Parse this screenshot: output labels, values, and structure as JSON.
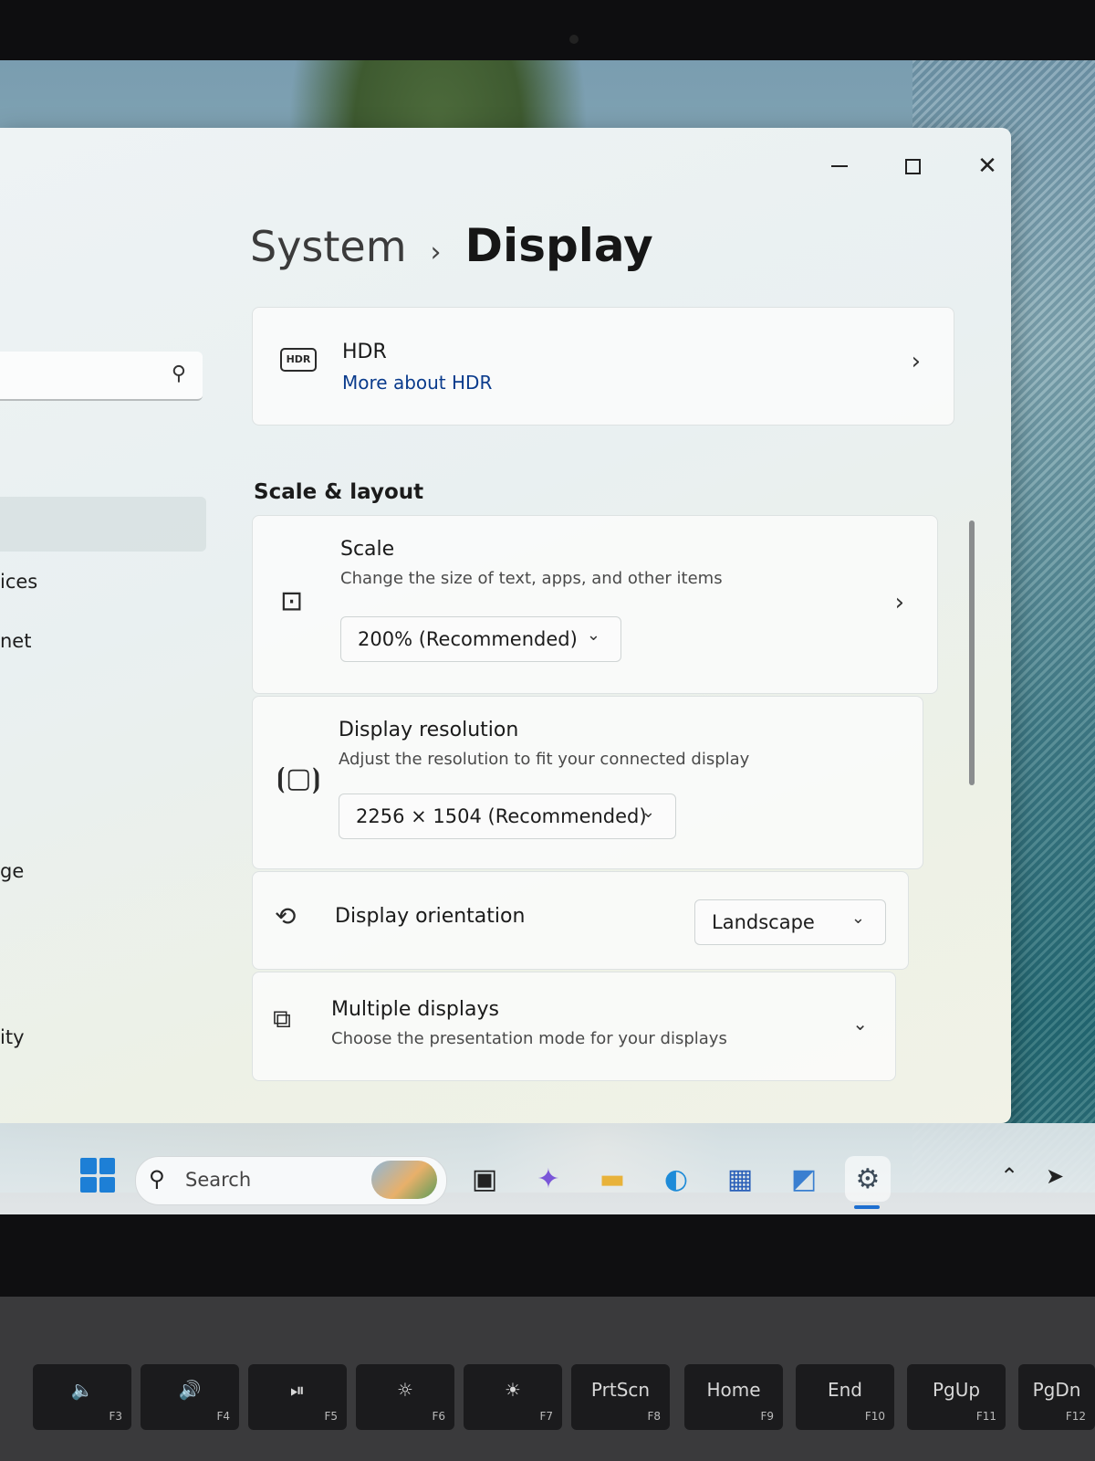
{
  "window": {
    "breadcrumb_parent": "System",
    "breadcrumb_separator": "›",
    "breadcrumb_current": "Display"
  },
  "sidebar": {
    "fragments": [
      "ices",
      "net",
      "ge",
      "ity"
    ]
  },
  "hdr_card": {
    "icon_label": "HDR",
    "title": "HDR",
    "link": "More about HDR"
  },
  "section": {
    "title": "Scale & layout"
  },
  "scale_card": {
    "title": "Scale",
    "subtitle": "Change the size of text, apps, and other items",
    "value": "200% (Recommended)"
  },
  "resolution_card": {
    "title": "Display resolution",
    "subtitle": "Adjust the resolution to fit your connected display",
    "value": "2256 × 1504 (Recommended)"
  },
  "orientation_card": {
    "title": "Display orientation",
    "value": "Landscape"
  },
  "multiple_card": {
    "title": "Multiple displays",
    "subtitle": "Choose the presentation mode for your displays"
  },
  "taskbar": {
    "search_label": "Search"
  },
  "keyboard": {
    "keys": [
      {
        "label": "🔈",
        "fn": "F3"
      },
      {
        "label": "🔊",
        "fn": "F4"
      },
      {
        "label": "⏯",
        "fn": "F5"
      },
      {
        "label": "☼",
        "fn": "F6"
      },
      {
        "label": "☀",
        "fn": "F7"
      },
      {
        "label": "PrtScn",
        "fn": "F8"
      },
      {
        "label": "Home",
        "fn": "F9"
      },
      {
        "label": "End",
        "fn": "F10"
      },
      {
        "label": "PgUp",
        "fn": "F11"
      },
      {
        "label": "PgDn",
        "fn": "F12"
      }
    ]
  },
  "colors": {
    "accent": "#1d6fd0",
    "link": "#0a3b8c"
  }
}
